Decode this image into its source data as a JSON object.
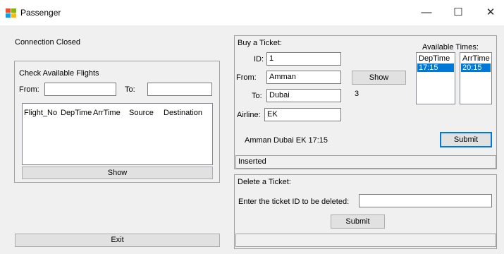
{
  "window": {
    "title": "Passenger",
    "minimize": "—",
    "maximize": "☐",
    "close": "✕"
  },
  "status": {
    "connection": "Connection Closed"
  },
  "check_flights": {
    "title": "Check Available Flights",
    "from_label": "From:",
    "from_value": "",
    "to_label": "To:",
    "to_value": "",
    "columns": [
      "Flight_No",
      "DepTime",
      "ArrTime",
      "Source",
      "Destination"
    ],
    "show_label": "Show"
  },
  "exit_label": "Exit",
  "buy": {
    "title": "Buy a Ticket:",
    "id_label": "ID:",
    "id_value": "1",
    "from_label": "From:",
    "from_value": "Amman",
    "to_label": "To:",
    "to_value": "Dubai",
    "airline_label": "Airline:",
    "airline_value": "EK",
    "show_label": "Show",
    "count": "3",
    "summary": "Amman Dubai EK 17:15",
    "submit_label": "Submit",
    "result": "Inserted",
    "available_times_label": "Available Times:",
    "dep_header": "DepTime",
    "dep_value": "17:15",
    "arr_header": "ArrTime",
    "arr_value": "20:15"
  },
  "delete": {
    "title": "Delete a Ticket:",
    "prompt": "Enter the ticket ID to be deleted:",
    "id_value": "",
    "submit_label": "Submit",
    "result": ""
  }
}
